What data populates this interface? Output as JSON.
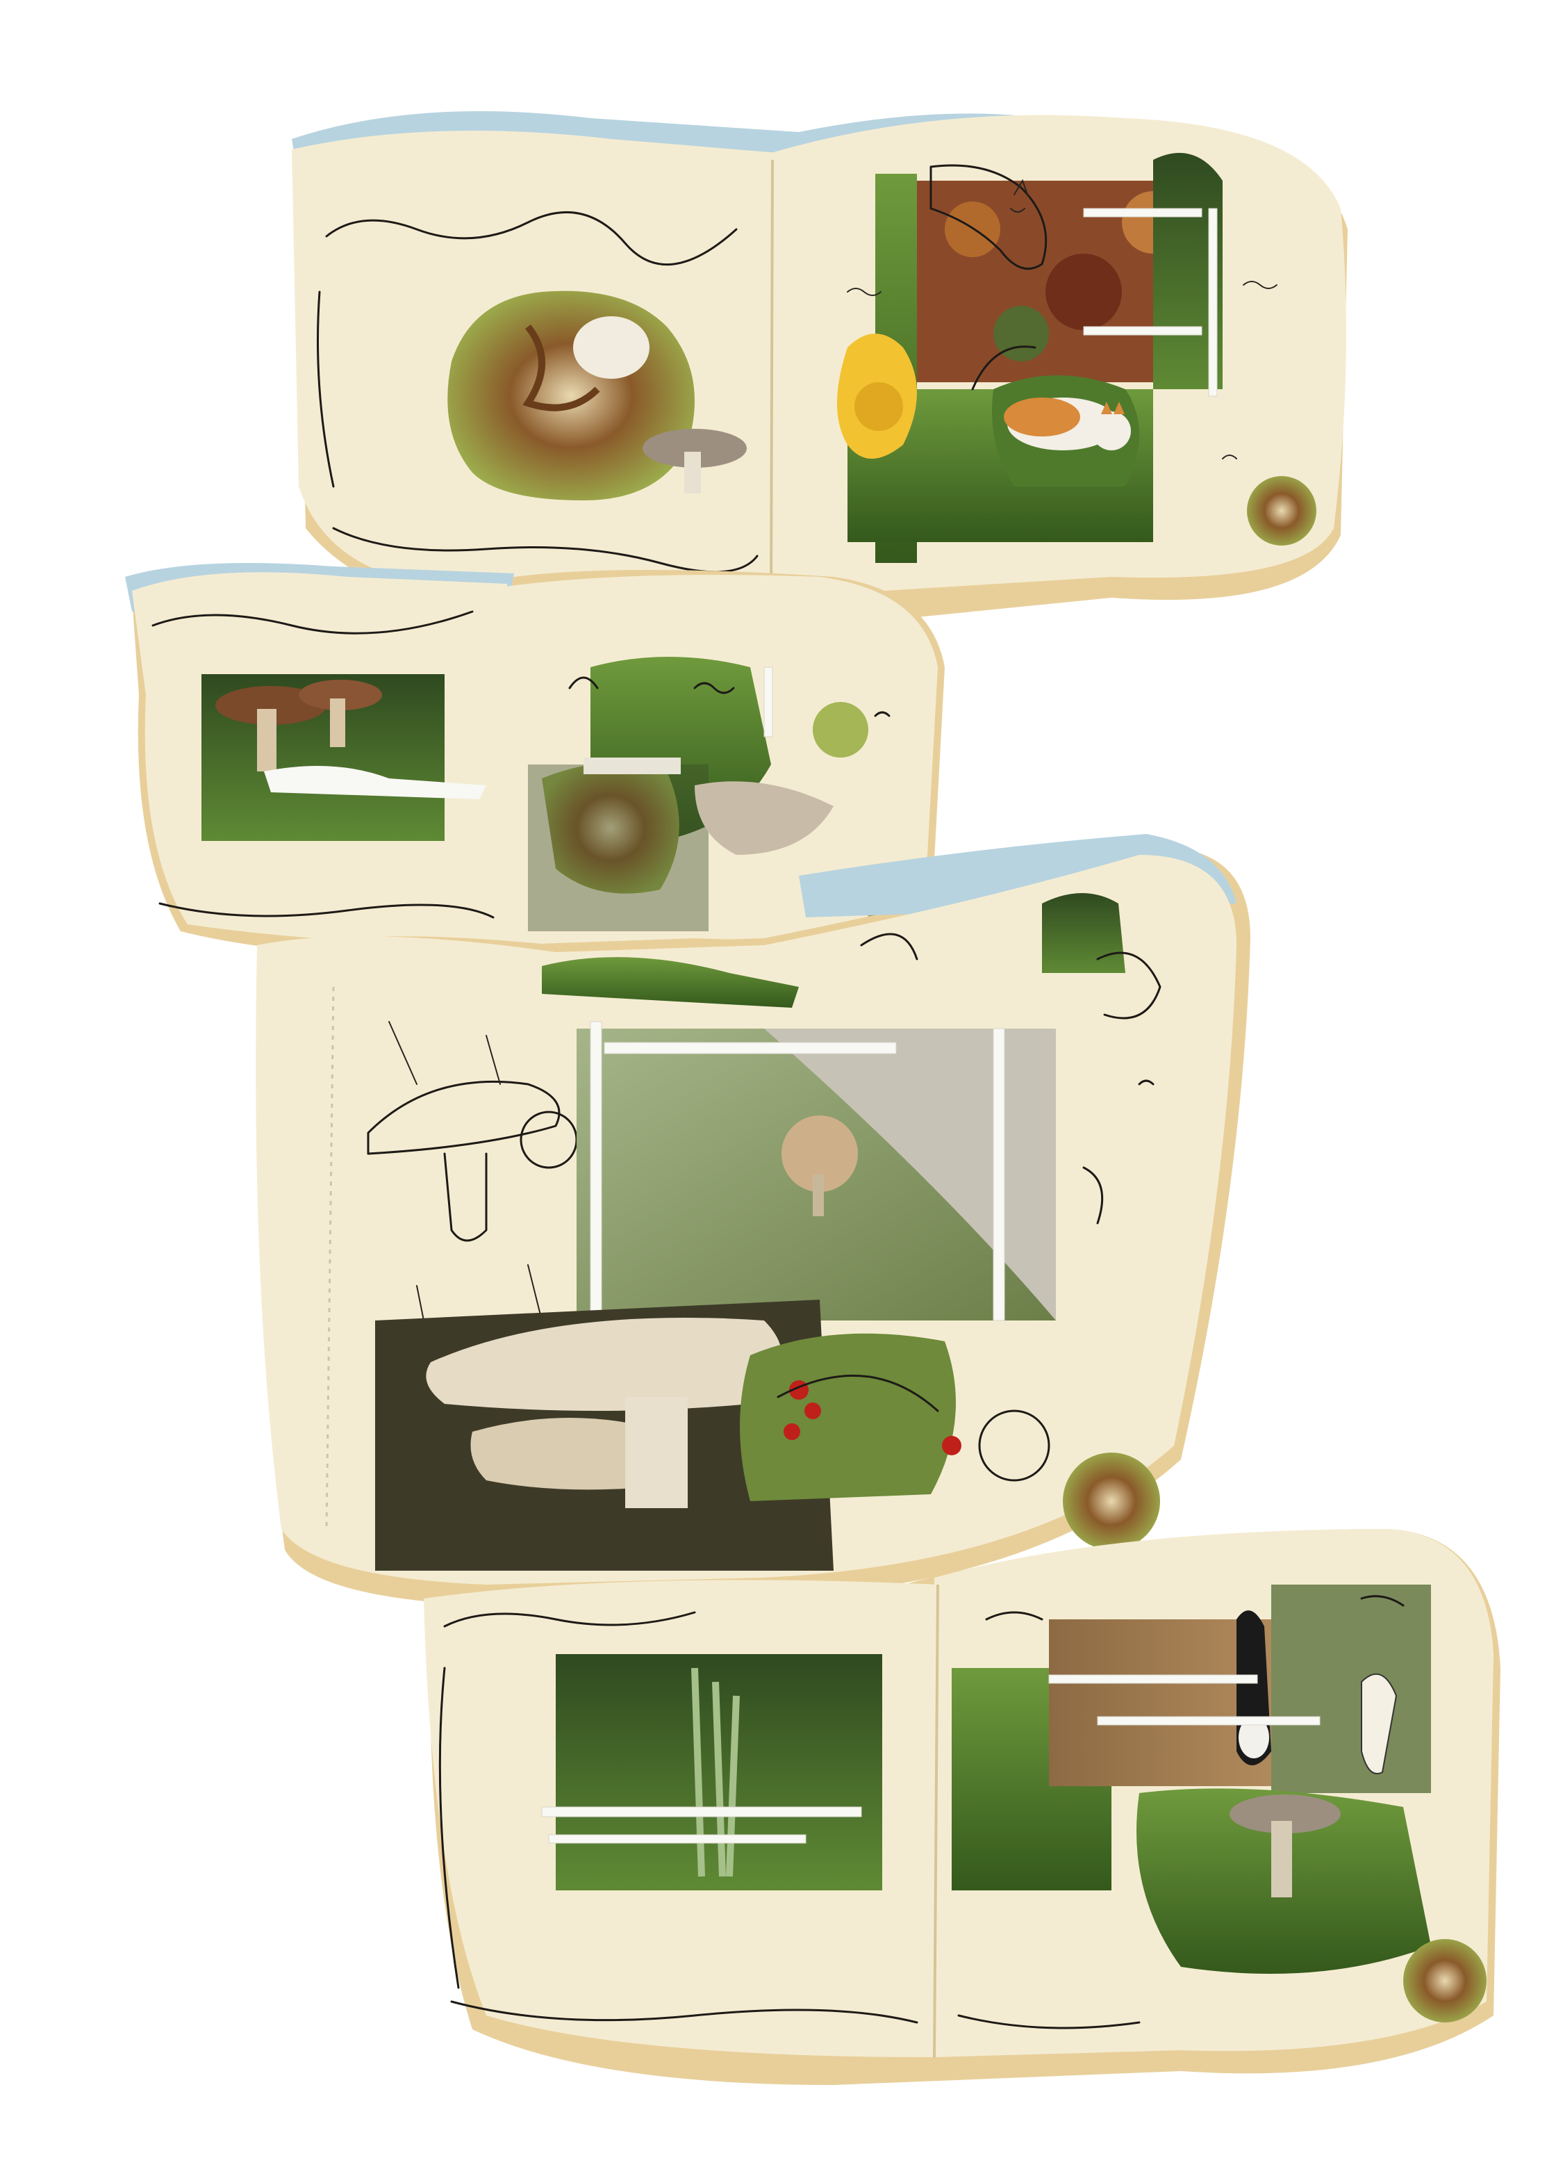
{
  "title": "",
  "artwork": {
    "description_visible_text": "",
    "spreads": [
      {
        "id": "spread-1",
        "subjects": [
          "apple-core",
          "mushroom",
          "cat-sketch",
          "yellow-rose",
          "ginger-cat",
          "autumn-leaves"
        ]
      },
      {
        "id": "spread-2",
        "subjects": [
          "brown-mushrooms",
          "grass",
          "collage-apple",
          "fabric-scraps"
        ]
      },
      {
        "id": "spread-3",
        "subjects": [
          "toadstool-sketch",
          "pale-mushrooms",
          "mossy-rock",
          "red-berries",
          "apple-core"
        ]
      },
      {
        "id": "spread-4",
        "subjects": [
          "wheat-grass",
          "black-white-cat",
          "mushroom",
          "apple-core"
        ]
      }
    ]
  },
  "colors": {
    "paper": "#f4ecd2",
    "paper_edge": "#e8cf9a",
    "sky": "#b7d3e0",
    "ink": "#1d1a17",
    "grass": "#4f7a2c",
    "moss": "#8fa36a",
    "mushroom_cap": "#c9a27a",
    "mushroom_dark": "#7a4a2a",
    "apple_green": "#a4b655",
    "rose_yellow": "#f2c230",
    "ginger": "#d98a3a",
    "berry_red": "#c0201a"
  }
}
